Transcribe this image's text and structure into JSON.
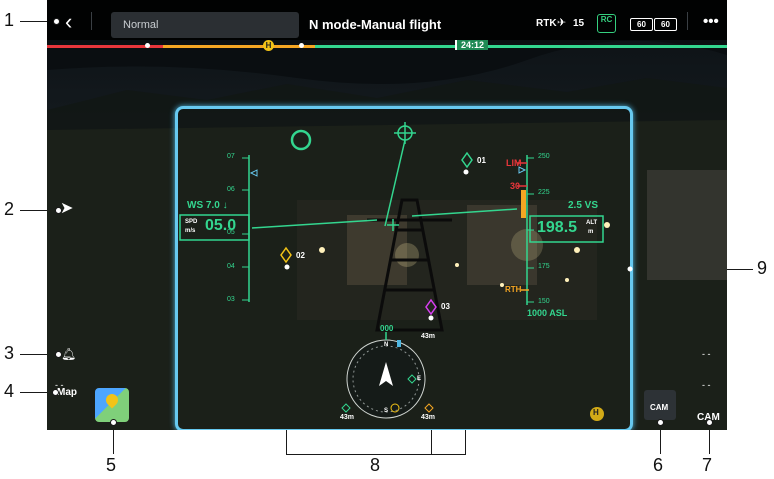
{
  "callouts": [
    "1",
    "2",
    "3",
    "4",
    "5",
    "6",
    "7",
    "8",
    "9"
  ],
  "topbar": {
    "mode": "Normal",
    "title": "N mode-Manual flight",
    "rtk": "RTK",
    "satellites": "15",
    "rc_label": "RC",
    "battery_left": "60",
    "battery_right": "60"
  },
  "timeline": {
    "remaining_time": "24:12",
    "home_marker": "H"
  },
  "hud": {
    "ws": "WS 7.0 ↓",
    "spd_label_top": "SPD",
    "spd_label_bottom": "m/s",
    "spd_value": "05.0",
    "alt_value": "198.5",
    "alt_label_top": "ALT",
    "alt_label_bottom": "m",
    "vs": "2.5 VS",
    "lim": "LIM",
    "rth": "RTH",
    "asl": "1000 ASL",
    "left_ticks": [
      "07",
      "06",
      "05",
      "04",
      "03"
    ],
    "right_ticks": [
      "250",
      "225",
      "200",
      "175",
      "150"
    ],
    "right_marker_30": "30",
    "waypoints": [
      "01",
      "02",
      "03"
    ],
    "heading": "000",
    "compass_n": "N",
    "compass_s": "S",
    "compass_e": "E",
    "dist_top": "43m",
    "dist_left": "43m",
    "dist_right": "43m",
    "home_badge": "H"
  },
  "bottom": {
    "map_label": "Map",
    "cam_label": "CAM",
    "cam_label2": "CAM",
    "dash1": "- -",
    "dash2": "- -",
    "dash3": "- -"
  },
  "colors": {
    "hud_green": "#33d68f",
    "frame_blue": "#67c9f0",
    "warn_red": "#e8363b",
    "orange": "#f5a623",
    "magenta": "#d83ef0",
    "yellow": "#f2c317"
  }
}
